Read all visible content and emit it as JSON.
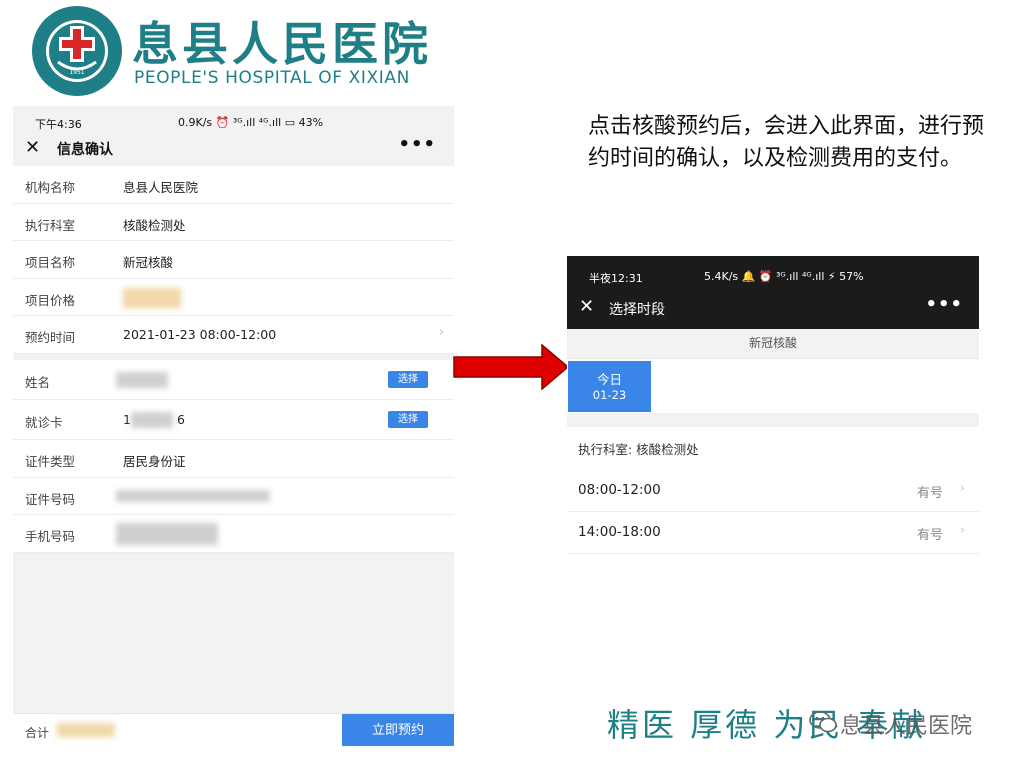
{
  "logo": {
    "chinese_name": "息县人民医院",
    "english_name": "PEOPLE'S HOSPITAL OF XIXIAN",
    "emblem_ring_text": "息县人民医院",
    "emblem_ring_en": "PEOPLE'S HOSPITAL OF XIXIAN",
    "emblem_year": "1951",
    "color": "#1f7f86"
  },
  "left_phone": {
    "status": {
      "time": "下午4:36",
      "indicators": "0.9K/s ⏰ ³ᴳ.ıll ⁴ᴳ.ıll ▭ 43%"
    },
    "nav": {
      "title": "信息确认",
      "close_icon": "close-icon",
      "more_icon": "more-icon"
    },
    "rows_group1": [
      {
        "label": "机构名称",
        "value": "息县人民医院"
      },
      {
        "label": "执行科室",
        "value": "核酸检测处"
      },
      {
        "label": "项目名称",
        "value": "新冠核酸"
      },
      {
        "label": "项目价格",
        "value": ""
      },
      {
        "label": "预约时间",
        "value": "2021-01-23  08:00-12:00",
        "chevron": "›"
      }
    ],
    "rows_group2": [
      {
        "label": "姓名",
        "value": "",
        "action": "选择"
      },
      {
        "label": "就诊卡",
        "value_prefix": "1",
        "value_suffix": "6",
        "action": "选择"
      },
      {
        "label": "证件类型",
        "value": "居民身份证"
      },
      {
        "label": "证件号码",
        "value": ""
      },
      {
        "label": "手机号码",
        "value": ""
      }
    ],
    "footer": {
      "total_label": "合计",
      "book_button": "立即预约"
    },
    "accent": "#3a86e8"
  },
  "description": "点击核酸预约后，会进入此界面，进行预约时间的确认，以及检测费用的支付。",
  "right_phone": {
    "status": {
      "time": "半夜12:31",
      "indicators": "5.4K/s 🔔 ⏰ ³ᴳ.ıll ⁴ᴳ.ıll ⚡ 57%"
    },
    "nav": {
      "title": "选择时段",
      "close_icon": "close-icon",
      "more_icon": "more-icon"
    },
    "project": "新冠核酸",
    "day": {
      "label": "今日",
      "date": "01-23"
    },
    "department": "执行科室:  核酸检测处",
    "slots": [
      {
        "time": "08:00-12:00",
        "status": "有号"
      },
      {
        "time": "14:00-18:00",
        "status": "有号"
      }
    ]
  },
  "arrow_color": "#e00000",
  "slogan": "精医 厚德 为民 奉献",
  "watermark": "息县人民医院"
}
